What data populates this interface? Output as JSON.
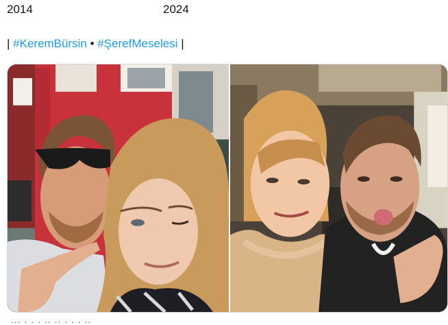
{
  "labels": {
    "year_left": "2014",
    "year_right": "2024"
  },
  "hashtags": {
    "separator_start": "|",
    "tag1": "#KeremBürsin",
    "dot": "•",
    "tag2": "#ŞerefMeselesi",
    "separator_end": "|"
  },
  "media": {
    "left_photo_icon": "selfie-photo-2014",
    "right_photo_icon": "selfie-photo-2024"
  },
  "cut_off_text": "... . . . .. .. . . . .."
}
